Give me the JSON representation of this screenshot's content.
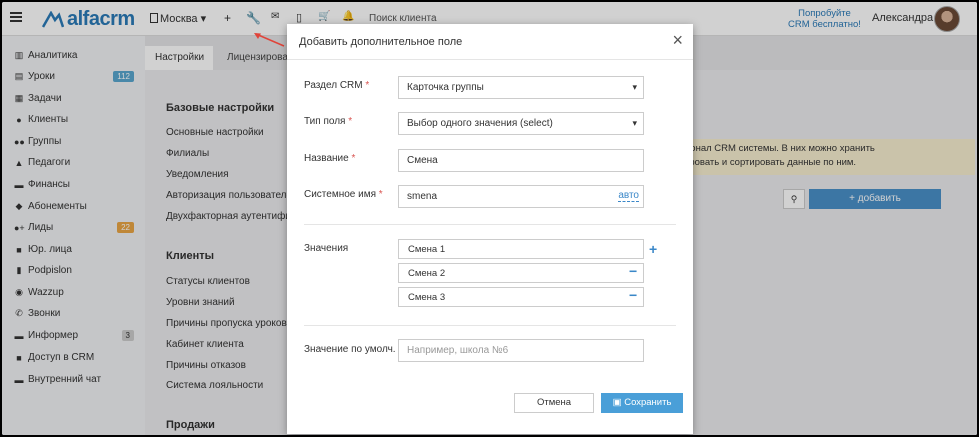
{
  "topbar": {
    "logo": "alfacrm",
    "city": "Москва",
    "search_placeholder": "Поиск клиента",
    "try_crm_line1": "Попробуйте",
    "try_crm_line2": "CRM бесплатно!",
    "user_name": "Александра"
  },
  "sidebar": {
    "items": [
      {
        "label": "Аналитика",
        "icon": "chart-icon"
      },
      {
        "label": "Уроки",
        "icon": "book-icon",
        "badge": "112"
      },
      {
        "label": "Задачи",
        "icon": "calendar-icon"
      },
      {
        "label": "Клиенты",
        "icon": "user-icon"
      },
      {
        "label": "Группы",
        "icon": "users-icon"
      },
      {
        "label": "Педагоги",
        "icon": "graduation-cap-icon"
      },
      {
        "label": "Финансы",
        "icon": "money-icon"
      },
      {
        "label": "Абонементы",
        "icon": "tag-icon"
      },
      {
        "label": "Лиды",
        "icon": "user-plus-icon",
        "badge": "22"
      },
      {
        "label": "Юр. лица",
        "icon": "briefcase-icon"
      },
      {
        "label": "Podpislon",
        "icon": "file-icon"
      },
      {
        "label": "Wazzup",
        "icon": "whatsapp-icon"
      },
      {
        "label": "Звонки",
        "icon": "phone-icon"
      },
      {
        "label": "Информер",
        "icon": "inbox-icon",
        "badge": "3"
      },
      {
        "label": "Доступ в CRM",
        "icon": "lock-icon"
      },
      {
        "label": "Внутренний чат",
        "icon": "chat-icon"
      }
    ]
  },
  "content": {
    "tabs": [
      "Настройки",
      "Лицензирование"
    ],
    "basic_title": "Базовые настройки",
    "basic_links": [
      "Основные настройки",
      "Филиалы",
      "Уведомления",
      "Авторизация пользователей",
      "Двухфакторная аутентификация"
    ],
    "clients_title": "Клиенты",
    "clients_links": [
      "Статусы клиентов",
      "Уровни знаний",
      "Причины пропуска уроков",
      "Кабинет клиента",
      "Причины отказов",
      "Система лояльности"
    ],
    "sales_title": "Продажи",
    "info_line1": "ионал CRM системы. В них можно хранить",
    "info_line2": "тровать и сортировать данные по ним.",
    "add_button": "+ добавить"
  },
  "modal": {
    "title": "Добавить дополнительное поле",
    "section_label": "Раздел CRM",
    "section_value": "Карточка группы",
    "type_label": "Тип поля",
    "type_value": "Выбор одного значения (select)",
    "name_label": "Название",
    "name_value": "Смена",
    "sysname_label": "Системное имя",
    "sysname_value": "smena",
    "auto_link": "авто",
    "values_label": "Значения",
    "values": [
      "Смена 1",
      "Смена 2",
      "Смена 3"
    ],
    "default_label": "Значение по умолч.",
    "default_placeholder": "Например, школа №6",
    "cancel": "Отмена",
    "save": "Сохранить"
  }
}
